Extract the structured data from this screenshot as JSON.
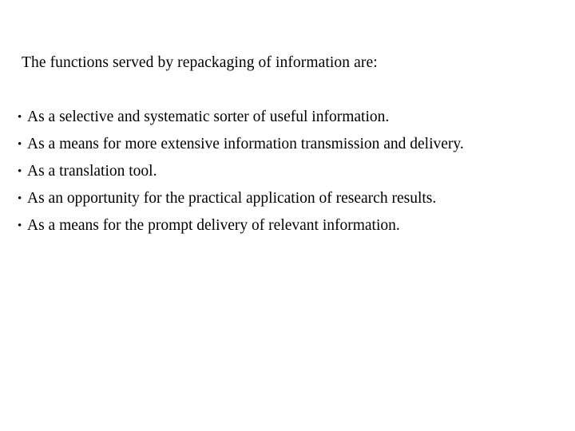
{
  "slide": {
    "background_color": "#ffffff",
    "text_color": "#000000",
    "intro": "The functions served by repackaging of information are:",
    "bullet_marker": "•",
    "bullets": [
      {
        "text": "As a selective and systematic sorter of useful information.",
        "justified": false
      },
      {
        "text": "As a means for more extensive information transmission and delivery.",
        "justified": true
      },
      {
        "text": "As a translation tool.",
        "justified": false
      },
      {
        "text": "As an opportunity for the practical application of research results.",
        "justified": true
      },
      {
        "text": "As a means for the prompt delivery of relevant information.",
        "justified": false
      }
    ]
  }
}
